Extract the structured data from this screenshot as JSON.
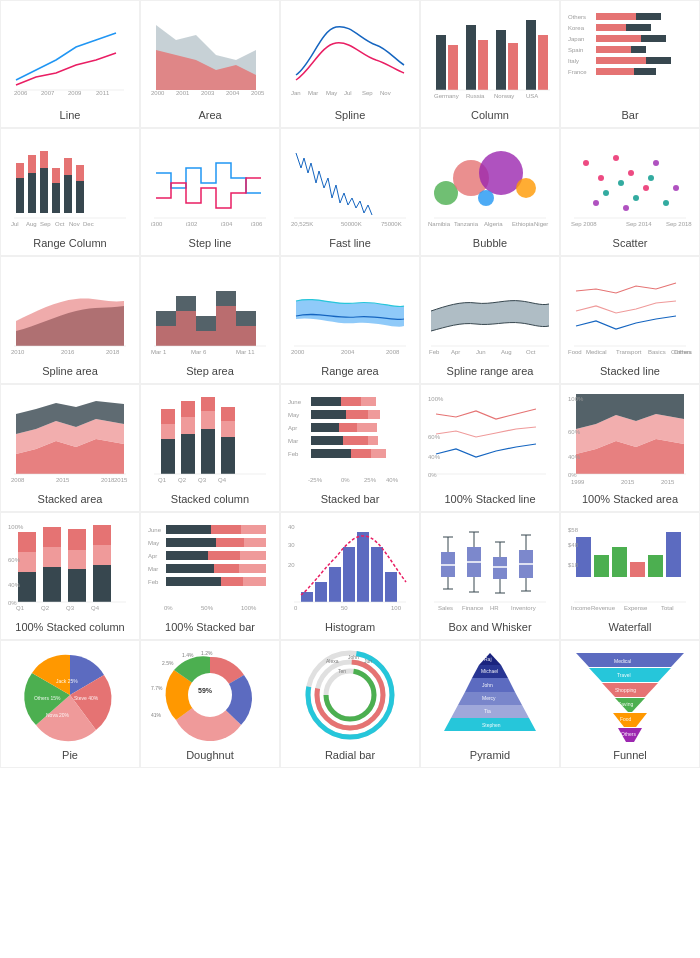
{
  "charts": [
    {
      "id": "line",
      "label": "Line"
    },
    {
      "id": "area",
      "label": "Area"
    },
    {
      "id": "spline",
      "label": "Spline"
    },
    {
      "id": "column",
      "label": "Column"
    },
    {
      "id": "bar",
      "label": "Bar"
    },
    {
      "id": "range-column",
      "label": "Range Column"
    },
    {
      "id": "step-line",
      "label": "Step line"
    },
    {
      "id": "fast-line",
      "label": "Fast line"
    },
    {
      "id": "bubble",
      "label": "Bubble"
    },
    {
      "id": "scatter",
      "label": "Scatter"
    },
    {
      "id": "spline-area",
      "label": "Spline area"
    },
    {
      "id": "step-area",
      "label": "Step area"
    },
    {
      "id": "range-area",
      "label": "Range area"
    },
    {
      "id": "spline-range-area",
      "label": "Spline range area"
    },
    {
      "id": "stacked-line",
      "label": "Stacked line"
    },
    {
      "id": "stacked-area",
      "label": "Stacked area"
    },
    {
      "id": "stacked-column",
      "label": "Stacked column"
    },
    {
      "id": "stacked-bar",
      "label": "Stacked bar"
    },
    {
      "id": "100-stacked-line",
      "label": "100% Stacked line"
    },
    {
      "id": "100-stacked-area",
      "label": "100% Stacked area"
    },
    {
      "id": "100-stacked-column",
      "label": "100% Stacked column"
    },
    {
      "id": "100-stacked-bar",
      "label": "100% Stacked bar"
    },
    {
      "id": "histogram",
      "label": "Histogram"
    },
    {
      "id": "box-whisker",
      "label": "Box and Whisker"
    },
    {
      "id": "waterfall",
      "label": "Waterfall"
    },
    {
      "id": "pie",
      "label": "Pie"
    },
    {
      "id": "doughnut",
      "label": "Doughnut"
    },
    {
      "id": "radial-bar",
      "label": "Radial bar"
    },
    {
      "id": "pyramid",
      "label": "Pyramid"
    },
    {
      "id": "funnel",
      "label": "Funnel"
    }
  ]
}
